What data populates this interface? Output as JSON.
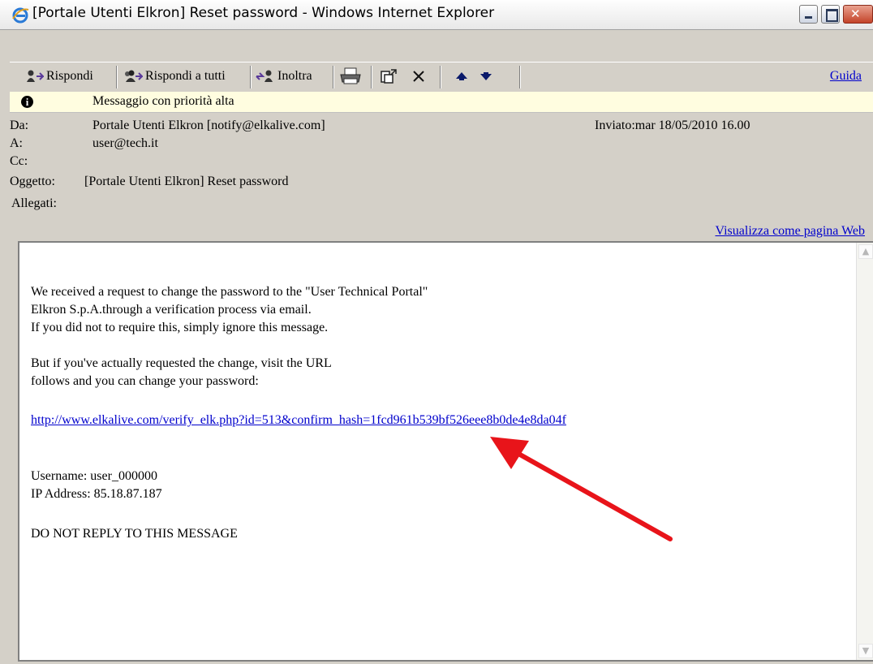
{
  "window": {
    "title": "[Portale Utenti Elkron] Reset password - Windows Internet Explorer"
  },
  "toolbar": {
    "reply": "Rispondi",
    "reply_all": "Rispondi a tutti",
    "forward": "Inoltra",
    "help": "Guida"
  },
  "priority_banner": "Messaggio con priorità alta",
  "header": {
    "from_label": "Da:",
    "from_value": "Portale Utenti Elkron [notify@elkalive.com]",
    "sent_label": "Inviato:",
    "sent_value": "mar 18/05/2010 16.00",
    "to_label": "A:",
    "to_value": "user@tech.it",
    "cc_label": "Cc:",
    "subject_label": "Oggetto:",
    "subject_value": "[Portale Utenti Elkron] Reset password",
    "attachments_label": "Allegati:"
  },
  "view_as_web": "Visualizza come pagina Web",
  "message": {
    "line1": "We received a request to change the password to the \"User Technical Portal\"",
    "line2": "Elkron S.p.A.through a verification process via email.",
    "line3": "If you did not to require this, simply ignore this message.",
    "line4": "But if you've actually requested the change, visit the URL",
    "line5": "follows and you can change your password:",
    "url": "http://www.elkalive.com/verify_elk.php?id=513&confirm_hash=1fcd961b539bf526eee8b0de4e8da04f",
    "username": "Username: user_000000",
    "ip": "IP Address: 85.18.87.187",
    "footer": "DO NOT REPLY TO THIS MESSAGE"
  },
  "annotation_color": "#e8141a"
}
